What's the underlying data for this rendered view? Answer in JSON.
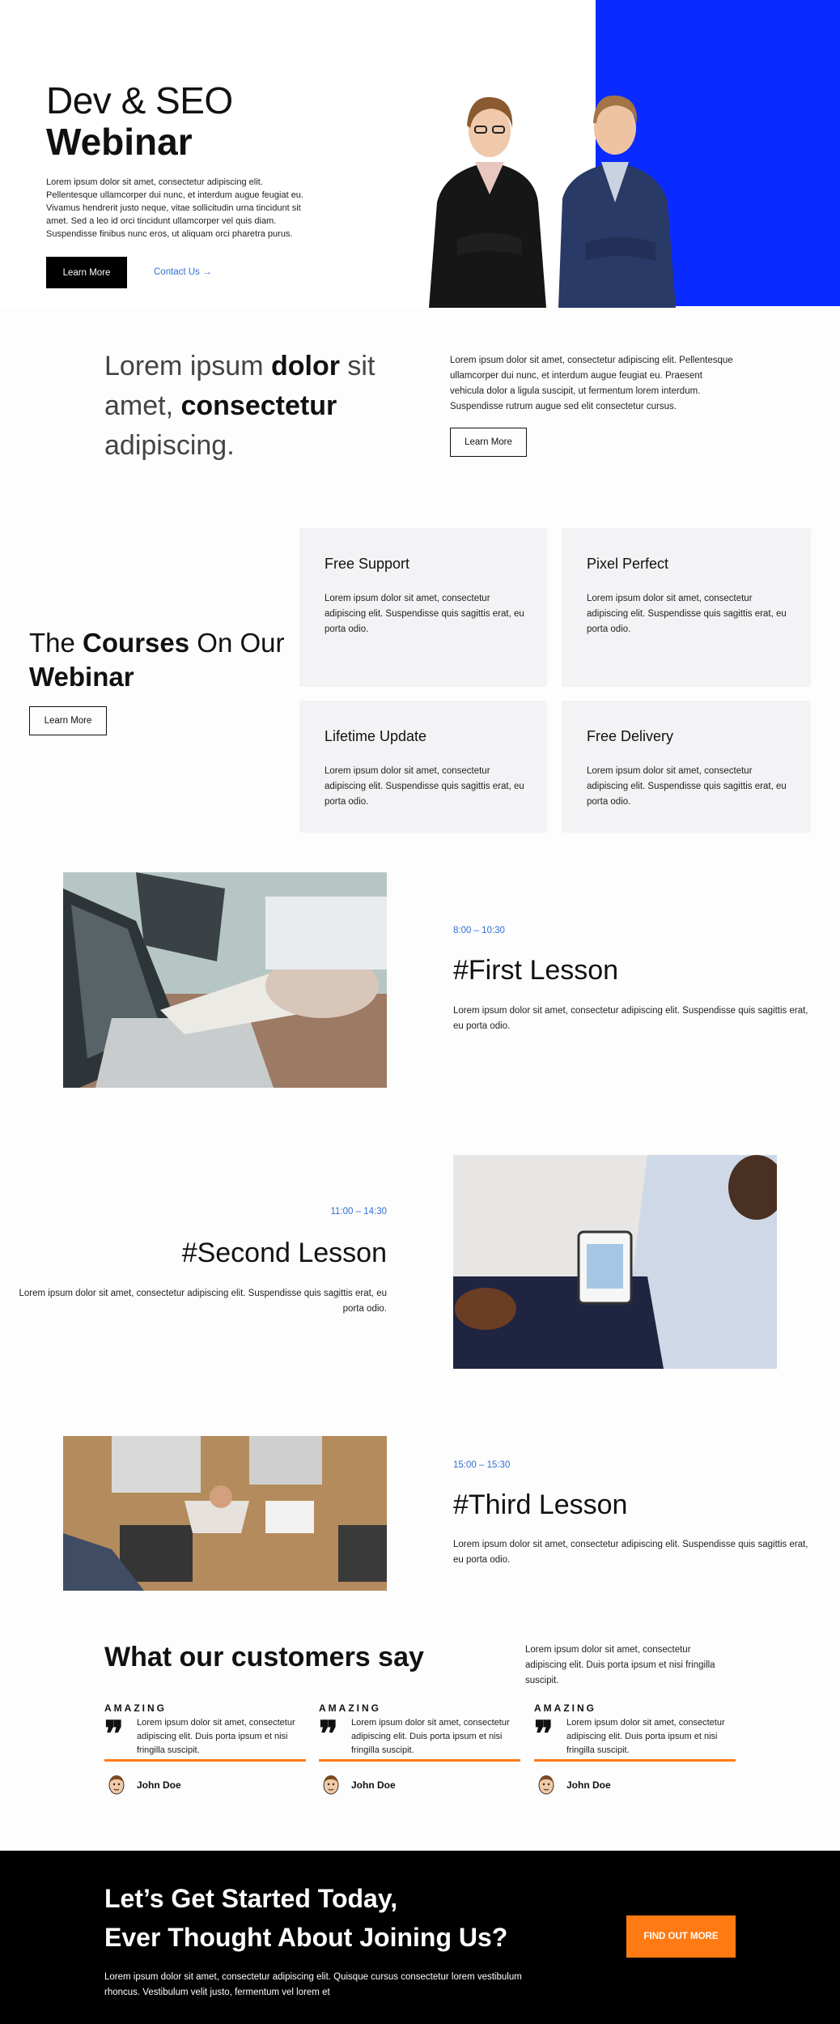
{
  "hero": {
    "title_line1": "Dev & SEO",
    "title_line2": "Webinar",
    "description": "Lorem ipsum dolor sit amet, consectetur adipiscing elit. Pellentesque ullamcorper dui nunc, et interdum augue feugiat eu. Vivamus hendrerit justo neque, vitae sollicitudin urna tincidunt sit amet. Sed a leo id orci tincidunt ullamcorper vel quis diam. Suspendisse finibus nunc eros, ut aliquam orci pharetra purus.",
    "primary_button": "Learn More",
    "contact_link": "Contact Us →",
    "accent_color": "#0a2bff"
  },
  "intro": {
    "heading_part1": "Lorem ipsum ",
    "heading_bold1": "dolor",
    "heading_part2": " sit amet, ",
    "heading_bold2": "consectetur",
    "heading_part3": " adipiscing.",
    "description": "Lorem ipsum dolor sit amet, consectetur adipiscing elit. Pellentesque ullamcorper dui nunc, et interdum augue feugiat eu. Praesent vehicula dolor a ligula suscipit, ut fermentum lorem interdum. Suspendisse rutrum augue sed elit consectetur cursus.",
    "button": "Learn More"
  },
  "courses": {
    "heading_part1": "The ",
    "heading_bold1": "Courses",
    "heading_part2": " On Our ",
    "heading_bold2": "Webinar",
    "button": "Learn More",
    "cards": [
      {
        "title": "Free Support",
        "text": "Lorem ipsum dolor sit amet, consectetur adipiscing elit. Suspendisse quis sagittis erat, eu porta odio."
      },
      {
        "title": "Pixel Perfect",
        "text": "Lorem ipsum dolor sit amet, consectetur adipiscing elit. Suspendisse quis sagittis erat, eu porta odio."
      },
      {
        "title": "Lifetime Update",
        "text": "Lorem ipsum dolor sit amet, consectetur adipiscing elit. Suspendisse quis sagittis erat, eu porta odio."
      },
      {
        "title": "Free Delivery",
        "text": "Lorem ipsum dolor sit amet, consectetur adipiscing elit. Suspendisse quis sagittis erat, eu porta odio."
      }
    ]
  },
  "lessons": [
    {
      "time": "8:00 – 10:30",
      "title": "#First Lesson",
      "text": "Lorem ipsum dolor sit amet, consectetur adipiscing elit. Suspendisse quis sagittis erat, eu porta odio."
    },
    {
      "time": "11:00 – 14:30",
      "title": "#Second Lesson",
      "text": "Lorem ipsum dolor sit amet, consectetur adipiscing elit. Suspendisse quis sagittis erat, eu porta odio."
    },
    {
      "time": "15:00 – 15:30",
      "title": "#Third Lesson",
      "text": "Lorem ipsum dolor sit amet, consectetur adipiscing elit. Suspendisse quis sagittis erat, eu porta odio."
    }
  ],
  "testimonials": {
    "heading": "What our customers say",
    "intro": "Lorem ipsum dolor sit amet, consectetur adipiscing elit. Duis porta ipsum et nisi fringilla suscipit.",
    "items": [
      {
        "label": "AMAZING",
        "quote_mark": "❞",
        "text": "Lorem ipsum dolor sit amet, consectetur adipiscing elit. Duis porta ipsum et nisi fringilla suscipit.",
        "name": "John Doe"
      },
      {
        "label": "AMAZING",
        "quote_mark": "❞",
        "text": "Lorem ipsum dolor sit amet, consectetur adipiscing elit. Duis porta ipsum et nisi fringilla suscipit.",
        "name": "John Doe"
      },
      {
        "label": "AMAZING",
        "quote_mark": "❞",
        "text": "Lorem ipsum dolor sit amet, consectetur adipiscing elit. Duis porta ipsum et nisi fringilla suscipit.",
        "name": "John Doe"
      }
    ],
    "accent_color": "#ff7a1a"
  },
  "cta": {
    "heading_line1": "Let’s Get Started Today,",
    "heading_line2": "Ever Thought About Joining Us?",
    "description": "Lorem ipsum dolor sit amet, consectetur adipiscing elit. Quisque cursus consectetur lorem vestibulum rhoncus. Vestibulum velit justo, fermentum vel lorem et",
    "button": "FIND OUT MORE",
    "button_color": "#ff7a12"
  }
}
